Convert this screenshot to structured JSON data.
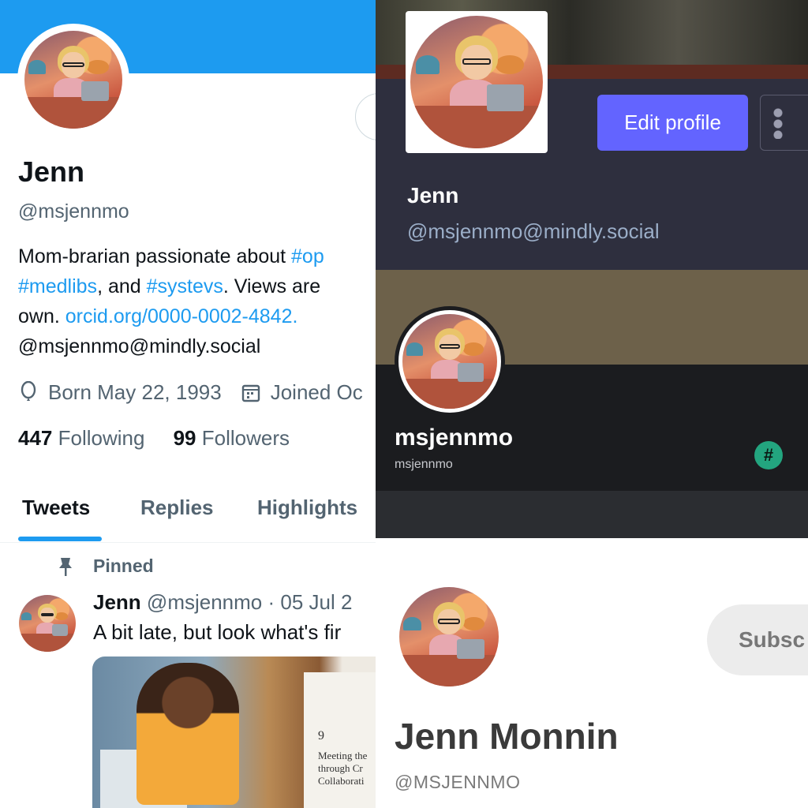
{
  "twitter": {
    "name": "Jenn",
    "handle": "@msjennmo",
    "bio": {
      "l1_text": "Mom-brarian passionate about ",
      "l1_link": "#op",
      "l2_link1": "#medlibs",
      "l2_mid": ", and ",
      "l2_link2": "#systevs",
      "l2_tail": ". Views are",
      "l3_text": "own. ",
      "l3_link": "orcid.org/0000-0002-4842.",
      "l4_text": "@msjennmo@mindly.social"
    },
    "born": "Born May 22, 1993",
    "joined": "Joined Oc",
    "following_count": "447",
    "following_label": "Following",
    "followers_count": "99",
    "followers_label": "Followers",
    "tabs": [
      "Tweets",
      "Replies",
      "Highlights"
    ],
    "pinned_label": "Pinned",
    "tweet": {
      "author": "Jenn",
      "handle_date": "@msjennmo · 05 Jul 2",
      "text": "A bit late, but look what's fir",
      "image_chapter": "9",
      "image_title": "Meeting the through Cr Collaborati"
    },
    "colors": {
      "accent": "#1d9bf0"
    }
  },
  "mastodon": {
    "edit_profile": "Edit profile",
    "name": "Jenn",
    "handle": "@msjennmo@mindly.social",
    "colors": {
      "button": "#6364ff"
    }
  },
  "discord": {
    "name": "msjennmo",
    "sub": "msjennmo",
    "badge": "#"
  },
  "substack": {
    "subscribe": "Subsc",
    "name": "Jenn Monnin",
    "handle": "@MSJENNMO"
  }
}
